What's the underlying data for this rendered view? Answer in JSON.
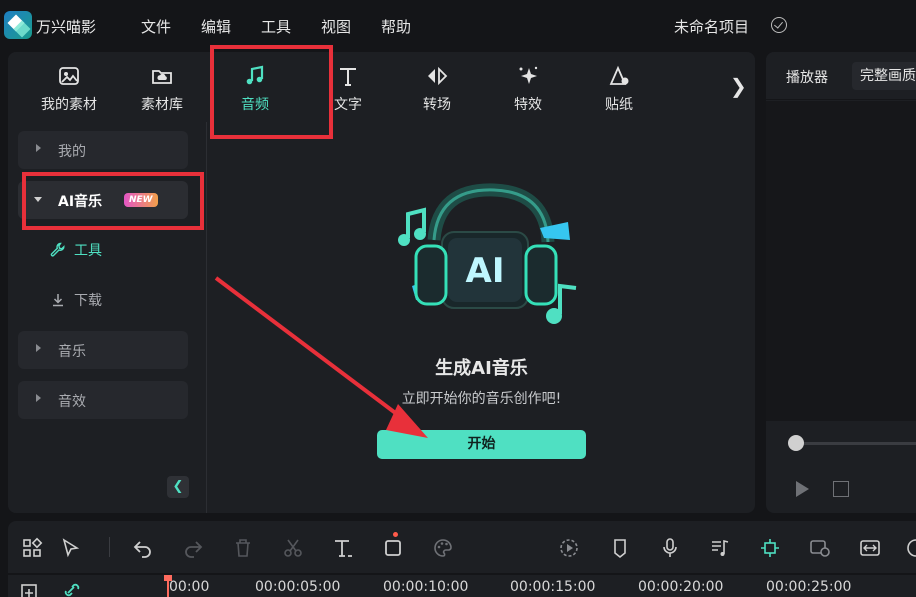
{
  "app": {
    "name": "万兴喵影",
    "project_name": "未命名项目"
  },
  "menu": [
    "文件",
    "编辑",
    "工具",
    "视图",
    "帮助"
  ],
  "tabs": [
    {
      "label": "我的素材",
      "icon": "image-icon"
    },
    {
      "label": "素材库",
      "icon": "cloud-folder-icon"
    },
    {
      "label": "音频",
      "icon": "music-note-icon",
      "active": true
    },
    {
      "label": "文字",
      "icon": "text-icon"
    },
    {
      "label": "转场",
      "icon": "transition-icon"
    },
    {
      "label": "特效",
      "icon": "sparkle-effect-icon"
    },
    {
      "label": "贴纸",
      "icon": "sticker-icon"
    }
  ],
  "sidebar": {
    "items": [
      {
        "label": "我的",
        "expanded": false
      },
      {
        "label": "AI音乐",
        "expanded": true,
        "badge": "NEW"
      },
      {
        "label": "音乐",
        "expanded": false
      },
      {
        "label": "音效",
        "expanded": false
      }
    ],
    "subitems": [
      {
        "label": "工具",
        "icon": "wrench-icon",
        "selected": true
      },
      {
        "label": "下载",
        "icon": "download-icon",
        "selected": false
      }
    ]
  },
  "content": {
    "title": "生成AI音乐",
    "subtitle": "立即开始你的音乐创作吧!",
    "button": "开始",
    "illustration_text": "AI"
  },
  "player": {
    "tab": "播放器",
    "quality": "完整画质"
  },
  "timeline": {
    "times": [
      "00:00",
      "00:00:05:00",
      "00:00:10:00",
      "00:00:15:00",
      "00:00:20:00",
      "00:00:25:00"
    ]
  },
  "colors": {
    "accent": "#4fe0c2",
    "highlight_box": "#e8303a",
    "badge_start": "#e356c6",
    "badge_end": "#f2a04a"
  }
}
